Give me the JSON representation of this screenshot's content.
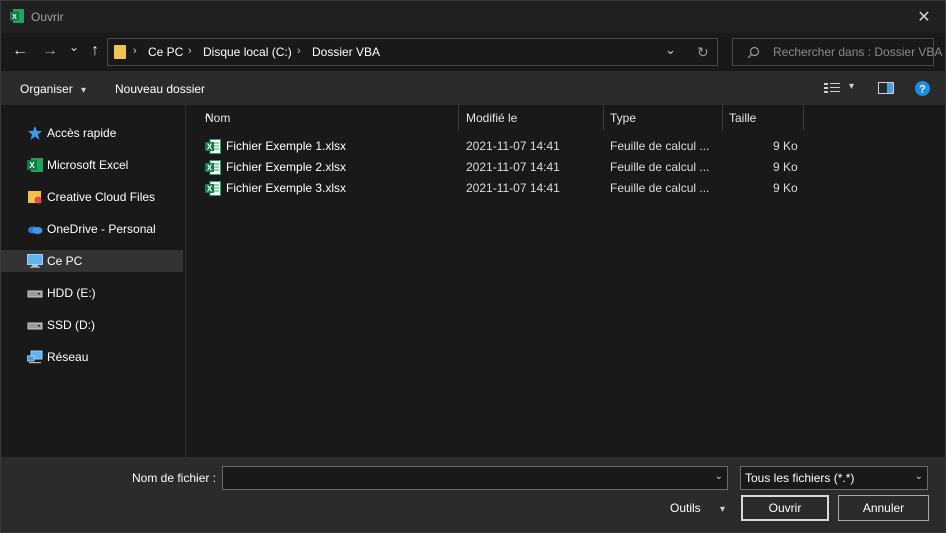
{
  "window": {
    "title": "Ouvrir",
    "close_glyph": "✕"
  },
  "nav": {
    "back": "←",
    "forward": "→",
    "recent": "⌄",
    "up": "↑",
    "breadcrumb": [
      "Ce PC",
      "Disque local (C:)",
      "Dossier VBA"
    ],
    "breadcrumb_sep": "›",
    "address_dropdown": "⌄",
    "refresh": "↻"
  },
  "search": {
    "placeholder": "Rechercher dans : Dossier VBA"
  },
  "toolbar": {
    "organize": "Organiser",
    "organize_arrow": "▾",
    "new_folder": "Nouveau dossier",
    "view_arrow": "▾"
  },
  "sidebar": {
    "items": [
      {
        "label": "Accès rapide",
        "icon": "star-icon"
      },
      {
        "label": "Microsoft Excel",
        "icon": "excel-icon"
      },
      {
        "label": "Creative Cloud Files",
        "icon": "creative-cloud-folder-icon"
      },
      {
        "label": "OneDrive - Personal",
        "icon": "onedrive-icon"
      },
      {
        "label": "Ce PC",
        "icon": "computer-icon",
        "selected": true
      },
      {
        "label": "HDD (E:)",
        "icon": "drive-icon"
      },
      {
        "label": "SSD (D:)",
        "icon": "drive-icon"
      },
      {
        "label": "Réseau",
        "icon": "network-icon"
      }
    ]
  },
  "files": {
    "columns": {
      "name": "Nom",
      "modified": "Modifié le",
      "type": "Type",
      "size": "Taille"
    },
    "sort_indicator": "^",
    "rows": [
      {
        "name": "Fichier Exemple 1.xlsx",
        "modified": "2021-11-07 14:41",
        "type": "Feuille de calcul ...",
        "size": "9 Ko"
      },
      {
        "name": "Fichier Exemple 2.xlsx",
        "modified": "2021-11-07 14:41",
        "type": "Feuille de calcul ...",
        "size": "9 Ko"
      },
      {
        "name": "Fichier Exemple 3.xlsx",
        "modified": "2021-11-07 14:41",
        "type": "Feuille de calcul ...",
        "size": "9 Ko"
      }
    ]
  },
  "footer": {
    "filename_label": "Nom de fichier :",
    "filename_value": "",
    "filter_value": "Tous les fichiers (*.*)",
    "dropdown_glyph": "⌄",
    "tools_label": "Outils",
    "tools_arrow": "▾",
    "open_button": "Ouvrir",
    "cancel_button": "Annuler"
  },
  "colors": {
    "accent_blue": "#1a8ee6",
    "excel_green": "#1e7a45",
    "folder_yellow": "#f1c34d"
  }
}
